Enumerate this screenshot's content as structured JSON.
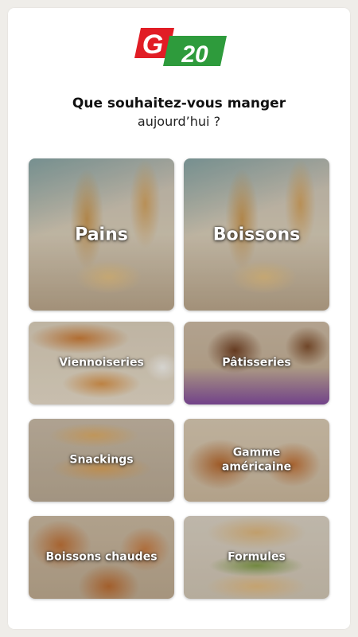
{
  "brand": {
    "logo_text": "G20",
    "colors": {
      "red": "#e11d25",
      "green": "#2e9b3c",
      "white": "#ffffff"
    }
  },
  "header": {
    "question_line1": "Que souhaitez-vous manger",
    "question_line2": "aujourd’hui ?"
  },
  "categories": [
    {
      "label": "Pains",
      "icon": "bread-photo"
    },
    {
      "label": "Boissons",
      "icon": "bread-photo"
    },
    {
      "label": "Viennoiseries",
      "icon": "croissant-photo"
    },
    {
      "label": "Pâtisseries",
      "icon": "muffin-photo"
    },
    {
      "label": "Snackings",
      "icon": "snack-photo"
    },
    {
      "label": "Gamme américaine",
      "icon": "pain-au-chocolat-photo"
    },
    {
      "label": "Boissons chaudes",
      "icon": "pastry-roll-photo"
    },
    {
      "label": "Formules",
      "icon": "sandwich-photo"
    }
  ]
}
